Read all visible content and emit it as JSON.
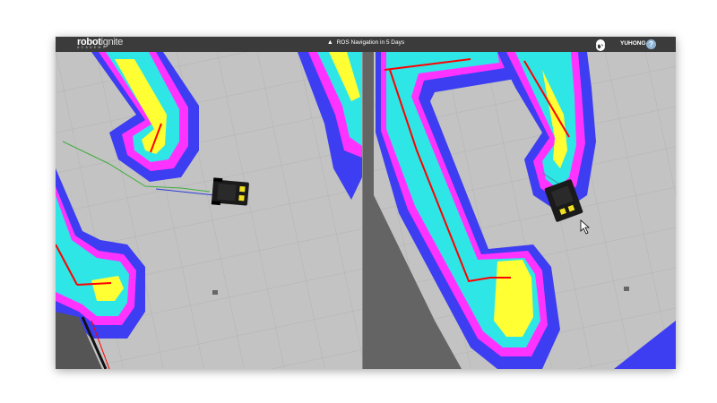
{
  "header": {
    "brand_primary": "robot",
    "brand_secondary": "ignite",
    "brand_sub": "ACADEMY",
    "course_icon": "graduation-cap-icon",
    "course_title": "ROS Navigation in 5 Days",
    "username": "YUHONG",
    "help_label": "?"
  },
  "colors": {
    "topbar": "#3b3b3b",
    "map_floor": "#c3c3c3",
    "costmap_outer": "#3d3df2",
    "costmap_mid": "#ff33ff",
    "costmap_inner": "#2ee6e6",
    "costmap_core": "#ffff33",
    "obstacle": "#ff0000"
  }
}
